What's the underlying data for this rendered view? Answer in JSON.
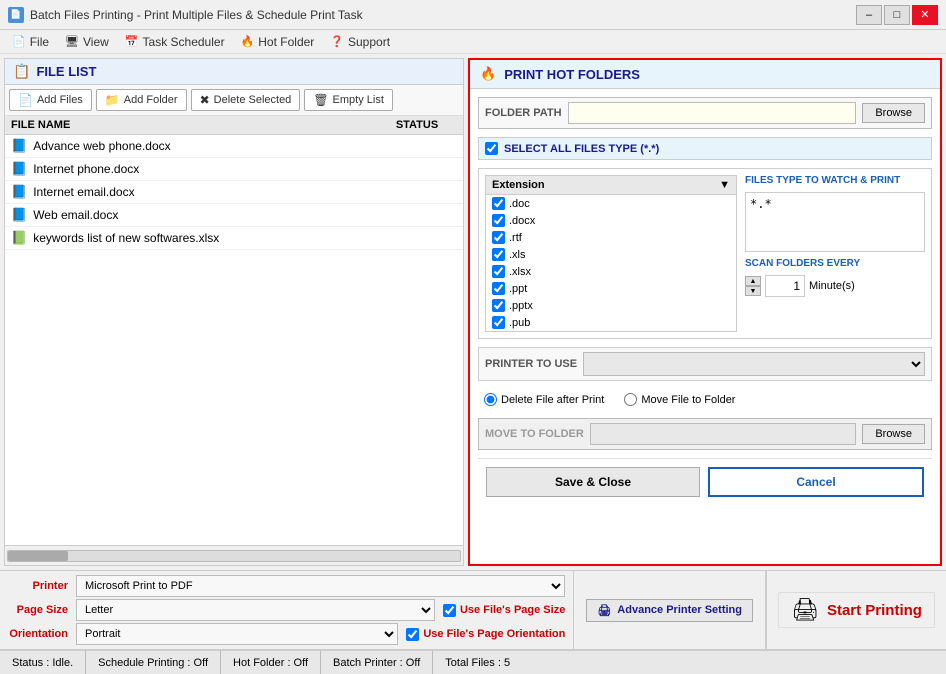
{
  "titleBar": {
    "icon": "📄",
    "title": "Batch Files Printing - Print Multiple Files & Schedule Print Task",
    "minimizeLabel": "–",
    "maximizeLabel": "□",
    "closeLabel": "✕"
  },
  "menuBar": {
    "items": [
      {
        "id": "file",
        "label": "File",
        "icon": "📄"
      },
      {
        "id": "view",
        "label": "View",
        "icon": "🖥"
      },
      {
        "id": "task-scheduler",
        "label": "Task Scheduler",
        "icon": "📅"
      },
      {
        "id": "hot-folder",
        "label": "Hot Folder",
        "icon": "🔥"
      },
      {
        "id": "support",
        "label": "Support",
        "icon": "❓"
      }
    ]
  },
  "fileList": {
    "panelTitle": "FILE LIST",
    "toolbar": {
      "addFiles": "Add Files",
      "addFolder": "Add Folder",
      "deleteSelected": "Delete Selected",
      "emptyList": "Empty List"
    },
    "columns": {
      "fileName": "FILE NAME",
      "status": "STATUS"
    },
    "files": [
      {
        "name": "Advance web phone.docx",
        "status": "",
        "icon": "📘"
      },
      {
        "name": "Internet phone.docx",
        "status": "",
        "icon": "📘"
      },
      {
        "name": "Internet email.docx",
        "status": "",
        "icon": "📘"
      },
      {
        "name": "Web email.docx",
        "status": "",
        "icon": "📘"
      },
      {
        "name": "keywords list of new softwares.xlsx",
        "status": "",
        "icon": "📗"
      }
    ]
  },
  "hotFolders": {
    "panelTitle": "PRINT HOT FOLDERS",
    "folderPath": {
      "label": "FOLDER PATH",
      "value": "",
      "placeholder": "",
      "browseLabel": "Browse"
    },
    "selectAllFiles": {
      "label": "SELECT ALL FILES TYPE (*.*)",
      "checked": true
    },
    "extensionList": {
      "header": "Extension",
      "items": [
        {
          "ext": ".doc",
          "checked": true
        },
        {
          "ext": ".docx",
          "checked": true
        },
        {
          "ext": ".rtf",
          "checked": true
        },
        {
          "ext": ".xls",
          "checked": true
        },
        {
          "ext": ".xlsx",
          "checked": true
        },
        {
          "ext": ".ppt",
          "checked": true
        },
        {
          "ext": ".pptx",
          "checked": true
        },
        {
          "ext": ".pub",
          "checked": true
        }
      ]
    },
    "filesTypeWatch": {
      "label": "FILES TYPE TO WATCH & PRINT",
      "value": "*.*"
    },
    "scanFolders": {
      "label": "SCAN FOLDERS EVERY",
      "value": "1",
      "unit": "Minute(s)"
    },
    "printerToUse": {
      "label": "PRINTER TO USE",
      "value": "",
      "placeholder": ""
    },
    "radioOptions": {
      "deleteFile": "Delete File after Print",
      "moveFile": "Move File to Folder",
      "selectedDelete": true
    },
    "moveToFolder": {
      "label": "MOVE TO FOLDER",
      "value": "",
      "browseLabel": "Browse"
    },
    "buttons": {
      "saveClose": "Save & Close",
      "cancel": "Cancel"
    }
  },
  "printSettings": {
    "printer": {
      "label": "Printer",
      "value": "Microsoft Print to PDF",
      "options": [
        "Microsoft Print to PDF"
      ]
    },
    "advancePrinterBtn": "Advance Printer Setting",
    "pageSize": {
      "label": "Page Size",
      "value": "Letter",
      "options": [
        "Letter"
      ]
    },
    "useFilesPageSize": {
      "label": "Use File's Page Size",
      "checked": true
    },
    "orientation": {
      "label": "Orientation",
      "value": "Portrait",
      "options": [
        "Portrait"
      ]
    },
    "useFilesPageOrientation": {
      "label": "Use File's Page Orientation",
      "checked": true
    },
    "startPrinting": "Start Printing"
  },
  "statusBar": {
    "status": "Status : Idle.",
    "schedulePrinting": "Schedule Printing : Off",
    "hotFolder": "Hot Folder : Off",
    "batchPrinter": "Batch Printer : Off",
    "totalFiles": "Total Files : 5"
  }
}
